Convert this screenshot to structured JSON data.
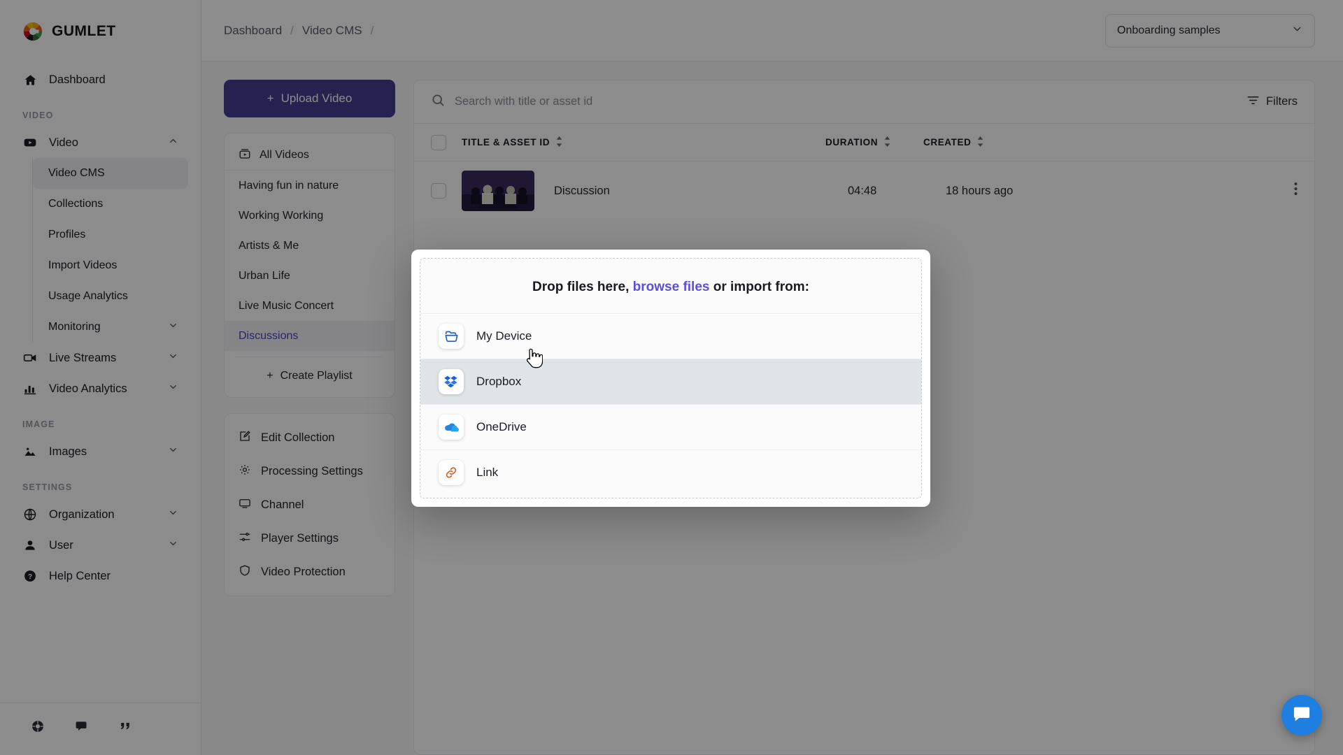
{
  "brand": {
    "name": "GUMLET"
  },
  "sidebar": {
    "dashboard": {
      "label": "Dashboard",
      "icon": "home-icon"
    },
    "sections": [
      {
        "label": "VIDEO",
        "items": [
          {
            "label": "Video",
            "icon": "video-icon",
            "chevron": "up",
            "expanded": true,
            "children": [
              {
                "label": "Video CMS",
                "active": true
              },
              {
                "label": "Collections",
                "active": false
              },
              {
                "label": "Profiles",
                "active": false
              },
              {
                "label": "Import Videos",
                "active": false
              },
              {
                "label": "Usage Analytics",
                "active": false
              },
              {
                "label": "Monitoring",
                "chevron": "down"
              }
            ]
          },
          {
            "label": "Live Streams",
            "icon": "livestream-icon",
            "chevron": "down"
          },
          {
            "label": "Video Analytics",
            "icon": "bar-chart-icon",
            "chevron": "down"
          }
        ]
      },
      {
        "label": "IMAGE",
        "items": [
          {
            "label": "Images",
            "icon": "image-icon",
            "chevron": "down"
          }
        ]
      },
      {
        "label": "SETTINGS",
        "items": [
          {
            "label": "Organization",
            "icon": "globe-icon",
            "chevron": "down"
          },
          {
            "label": "User",
            "icon": "user-icon",
            "chevron": "down"
          },
          {
            "label": "Help Center",
            "icon": "help-circle-icon"
          }
        ]
      }
    ],
    "footer_icons": [
      "support-icon",
      "chat-icon",
      "quote-icon"
    ]
  },
  "topbar": {
    "breadcrumbs": [
      "Dashboard",
      "Video CMS",
      ""
    ],
    "separator": "/",
    "org_selector": {
      "value": "Onboarding samples",
      "icon": "chevron-down-icon"
    }
  },
  "left_panel": {
    "upload_button": {
      "label": "Upload Video",
      "plus": "+"
    },
    "all_videos": {
      "label": "All Videos",
      "icon": "all-videos-icon"
    },
    "playlists": [
      {
        "label": "Having fun in nature",
        "selected": false
      },
      {
        "label": "Working Working",
        "selected": false
      },
      {
        "label": "Artists & Me",
        "selected": false
      },
      {
        "label": "Urban Life",
        "selected": false
      },
      {
        "label": "Live Music Concert",
        "selected": false
      },
      {
        "label": "Discussions",
        "selected": true
      }
    ],
    "create_playlist": {
      "label": "Create Playlist",
      "plus": "+"
    },
    "actions": [
      {
        "label": "Edit Collection",
        "icon": "edit-square-icon"
      },
      {
        "label": "Processing Settings",
        "icon": "gear-icon"
      },
      {
        "label": "Channel",
        "icon": "monitor-icon"
      },
      {
        "label": "Player Settings",
        "icon": "sliders-icon"
      },
      {
        "label": "Video Protection",
        "icon": "shield-icon"
      }
    ]
  },
  "table": {
    "search": {
      "placeholder": "Search with title or asset id",
      "value": "",
      "icon": "search-icon"
    },
    "filters": {
      "label": "Filters",
      "icon": "filter-icon"
    },
    "columns": [
      {
        "label": "TITLE & ASSET ID",
        "sortable": true
      },
      {
        "label": "DURATION",
        "sortable": true
      },
      {
        "label": "CREATED",
        "sortable": true
      }
    ],
    "rows": [
      {
        "title": "Discussion",
        "duration": "04:48",
        "created": "18 hours ago",
        "menu_icon": "kebab-menu-icon"
      }
    ]
  },
  "modal": {
    "title_prefix": "Drop files here, ",
    "title_link": "browse files",
    "title_suffix": " or import from:",
    "sources": [
      {
        "label": "My Device",
        "icon": "folder-icon",
        "hover": false
      },
      {
        "label": "Dropbox",
        "icon": "dropbox-icon",
        "hover": true
      },
      {
        "label": "OneDrive",
        "icon": "onedrive-icon",
        "hover": false
      },
      {
        "label": "Link",
        "icon": "link-icon",
        "hover": false
      }
    ]
  },
  "widget": {
    "intercom": {
      "icon": "chat-bubble-icon",
      "color": "#1f7fe0"
    }
  },
  "colors": {
    "accent": "#453f91",
    "link": "#5b4fdb",
    "selected_text": "#4b43b8",
    "hover_row": "#dfe4e8",
    "intercom": "#1f7fe0"
  }
}
